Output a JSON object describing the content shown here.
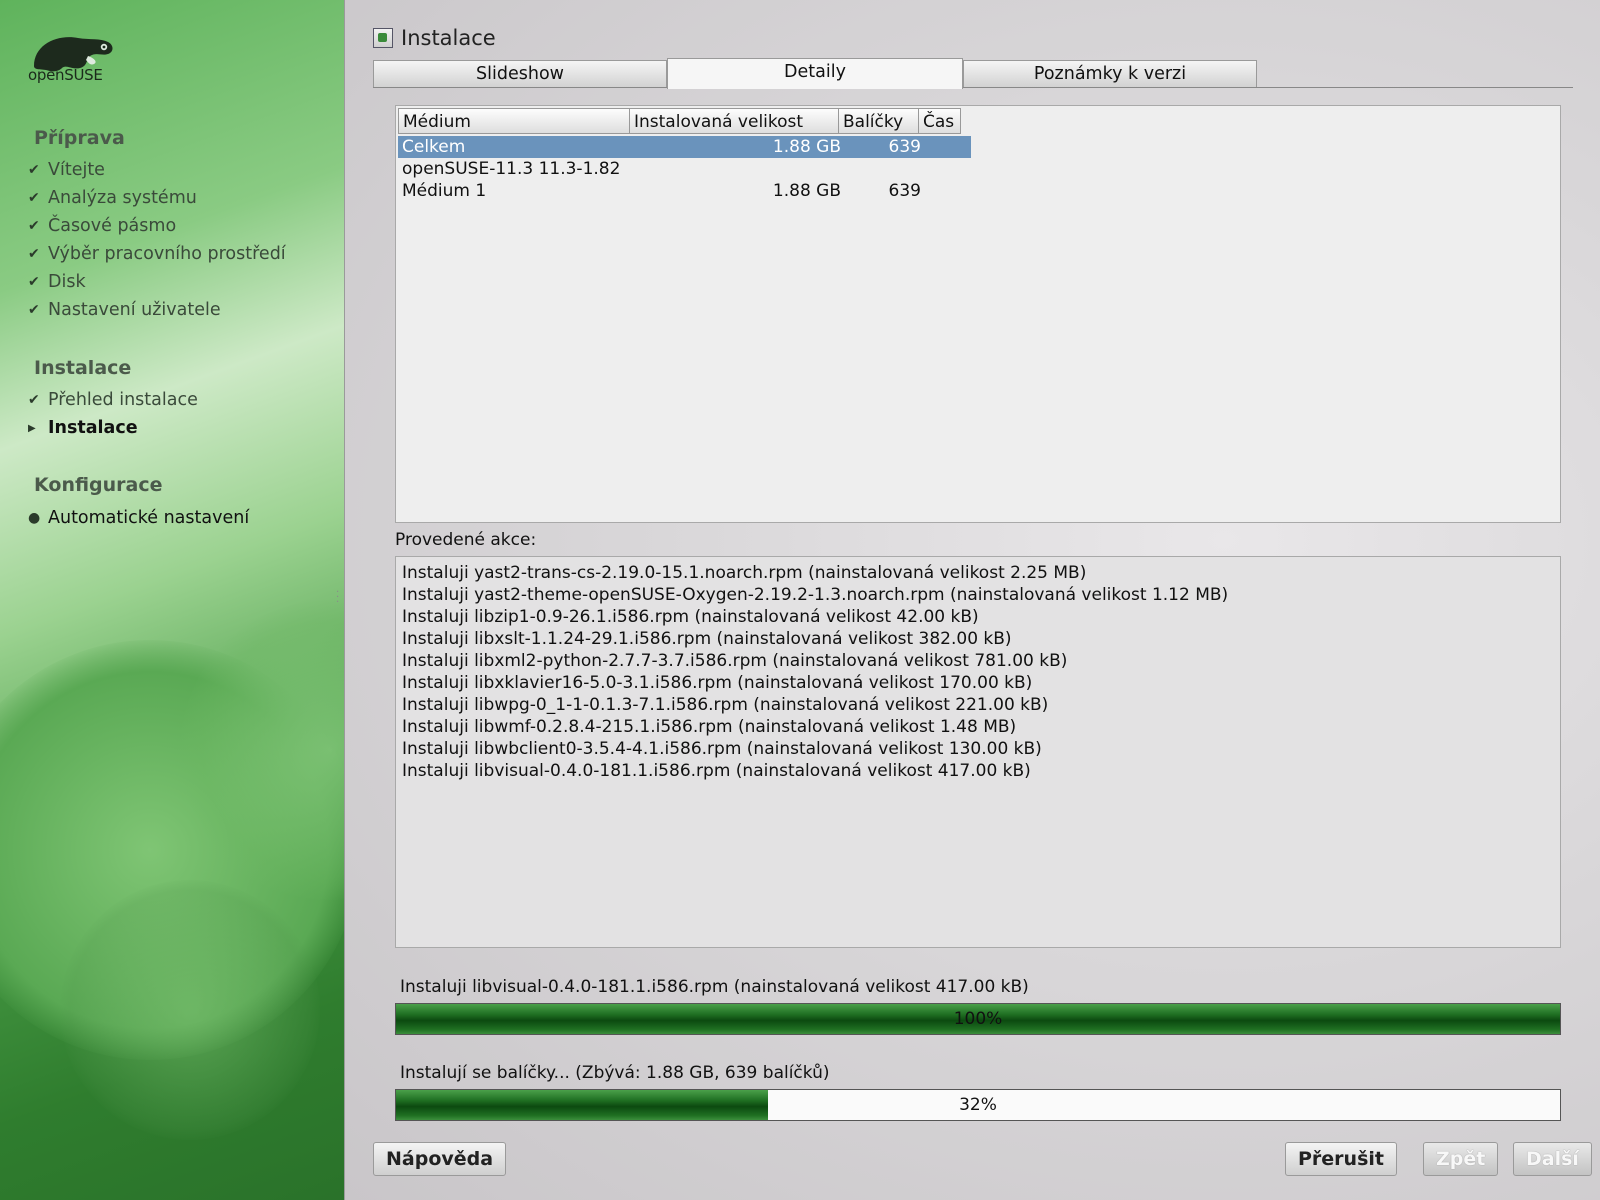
{
  "sidebar": {
    "logo": {
      "brand": "openSUSE"
    },
    "sections": [
      {
        "title": "Příprava",
        "steps": [
          {
            "label": "Vítejte",
            "status": "done"
          },
          {
            "label": "Analýza systému",
            "status": "done"
          },
          {
            "label": "Časové pásmo",
            "status": "done"
          },
          {
            "label": "Výběr pracovního prostředí",
            "status": "done"
          },
          {
            "label": "Disk",
            "status": "done"
          },
          {
            "label": "Nastavení uživatele",
            "status": "done"
          }
        ]
      },
      {
        "title": "Instalace",
        "steps": [
          {
            "label": "Přehled instalace",
            "status": "done"
          },
          {
            "label": "Instalace",
            "status": "current"
          }
        ]
      },
      {
        "title": "Konfigurace",
        "steps": [
          {
            "label": "Automatické nastavení",
            "status": "pending"
          }
        ]
      }
    ]
  },
  "header": {
    "title": "Instalace"
  },
  "tabs": [
    {
      "label": "Slideshow",
      "active": false
    },
    {
      "label": "Detaily",
      "active": true
    },
    {
      "label": "Poznámky k verzi",
      "active": false
    }
  ],
  "summary_table": {
    "columns": [
      "Médium",
      "Instalovaná velikost",
      "Balíčky",
      "Čas"
    ],
    "rows": [
      {
        "medium": "Celkem",
        "size": "1.88 GB",
        "packages": "639",
        "time": "",
        "selected": true
      },
      {
        "medium": "openSUSE-11.3 11.3-1.82",
        "size": "",
        "packages": "",
        "time": "",
        "selected": false
      },
      {
        "medium": "Médium 1",
        "size": "1.88 GB",
        "packages": "639",
        "time": "",
        "selected": false
      }
    ]
  },
  "log": {
    "label": "Provedené akce:",
    "lines": [
      "Instaluji yast2-trans-cs-2.19.0-15.1.noarch.rpm (nainstalovaná velikost 2.25 MB)",
      "Instaluji yast2-theme-openSUSE-Oxygen-2.19.2-1.3.noarch.rpm (nainstalovaná velikost 1.12 MB)",
      "Instaluji libzip1-0.9-26.1.i586.rpm (nainstalovaná velikost 42.00 kB)",
      "Instaluji libxslt-1.1.24-29.1.i586.rpm (nainstalovaná velikost 382.00 kB)",
      "Instaluji libxml2-python-2.7.7-3.7.i586.rpm (nainstalovaná velikost 781.00 kB)",
      "Instaluji libxklavier16-5.0-3.1.i586.rpm (nainstalovaná velikost 170.00 kB)",
      "Instaluji libwpg-0_1-1-0.1.3-7.1.i586.rpm (nainstalovaná velikost 221.00 kB)",
      "Instaluji libwmf-0.2.8.4-215.1.i586.rpm (nainstalovaná velikost 1.48 MB)",
      "Instaluji libwbclient0-3.5.4-4.1.i586.rpm (nainstalovaná velikost 130.00 kB)",
      "Instaluji libvisual-0.4.0-181.1.i586.rpm (nainstalovaná velikost 417.00 kB)"
    ]
  },
  "package_progress": {
    "label": "Instaluji libvisual-0.4.0-181.1.i586.rpm (nainstalovaná velikost 417.00 kB)",
    "percent": 100,
    "percent_text": "100%"
  },
  "total_progress": {
    "label": "Instalují se balíčky... (Zbývá: 1.88 GB, 639 balíčků)",
    "percent": 32,
    "percent_text": "32%"
  },
  "buttons": {
    "help": "Nápověda",
    "abort": "Přerušit",
    "back": "Zpět",
    "next": "Další"
  },
  "colors": {
    "selection": "#6a93bc",
    "progress_green": "#1f6f22",
    "sidebar_green": "#4a9d47"
  },
  "icons": {
    "done": "checkmark-icon",
    "current": "triangle-right-icon",
    "pending": "bullet-icon"
  }
}
